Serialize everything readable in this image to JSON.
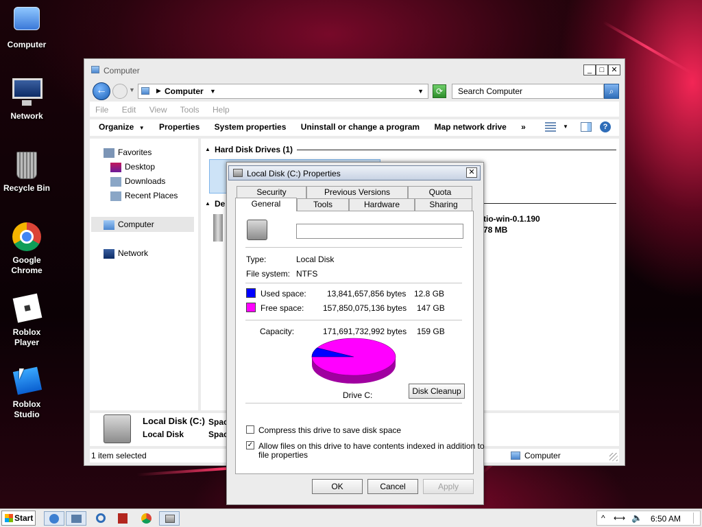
{
  "desktop": {
    "icons": [
      {
        "label": "Computer"
      },
      {
        "label": "Network"
      },
      {
        "label": "Recycle Bin"
      },
      {
        "label": "Google Chrome"
      },
      {
        "label": "Roblox Player"
      },
      {
        "label": "Roblox Studio"
      }
    ]
  },
  "explorer": {
    "title": "Computer",
    "address": "Computer",
    "search_placeholder": "Search Computer",
    "menu": [
      "File",
      "Edit",
      "View",
      "Tools",
      "Help"
    ],
    "commands": [
      "Organize",
      "Properties",
      "System properties",
      "Uninstall or change a program",
      "Map network drive",
      "»"
    ],
    "nav": {
      "favorites": "Favorites",
      "desktop": "Desktop",
      "downloads": "Downloads",
      "recent_places": "Recent Places",
      "computer": "Computer",
      "network": "Network"
    },
    "groups": {
      "hard_disk": "Hard Disk Drives (1)",
      "devices_partial": "De"
    },
    "partial_item": {
      "name": "tio-win-0.1.190",
      "size": "78 MB"
    },
    "details": {
      "name": "Local Disk (C:)",
      "type": "Local Disk",
      "space_label_1": "Spac",
      "space_label_2": "Spac"
    },
    "status": {
      "left": "1 item selected",
      "right": "Computer"
    }
  },
  "dialog": {
    "title": "Local Disk (C:) Properties",
    "tabs_row1": [
      "Security",
      "Previous Versions",
      "Quota"
    ],
    "tabs_row2": [
      "General",
      "Tools",
      "Hardware",
      "Sharing"
    ],
    "active_tab": "General",
    "label_value": "",
    "type_label": "Type:",
    "type_value": "Local Disk",
    "fs_label": "File system:",
    "fs_value": "NTFS",
    "used_label": "Used space:",
    "used_bytes": "13,841,657,856 bytes",
    "used_gb": "12.8 GB",
    "free_label": "Free space:",
    "free_bytes": "157,850,075,136 bytes",
    "free_gb": "147 GB",
    "capacity_label": "Capacity:",
    "capacity_bytes": "171,691,732,992 bytes",
    "capacity_gb": "159 GB",
    "used_color": "#0000ff",
    "free_color": "#ff00ff",
    "used_fraction": 0.0806,
    "drive_label": "Drive C:",
    "cleanup": "Disk Cleanup",
    "compress_label": "Compress this drive to save disk space",
    "compress_checked": false,
    "index_label_1": "Allow files on this drive to have contents indexed in addition to",
    "index_label_2": "file properties",
    "index_checked": true,
    "ok": "OK",
    "cancel": "Cancel",
    "apply": "Apply"
  },
  "taskbar": {
    "start": "Start",
    "clock": "6:50 AM"
  }
}
